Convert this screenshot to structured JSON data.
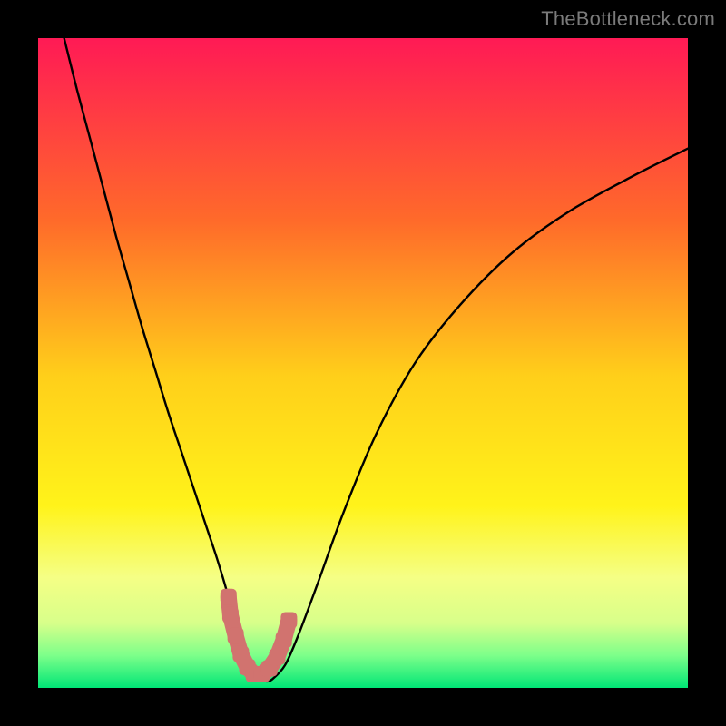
{
  "watermark": "TheBottleneck.com",
  "chart_data": {
    "type": "line",
    "title": "",
    "xlabel": "",
    "ylabel": "",
    "xlim": [
      0,
      100
    ],
    "ylim": [
      0,
      100
    ],
    "background_gradient": {
      "top": "#ff1a55",
      "mid_upper": "#ff8a1a",
      "mid": "#ffe81a",
      "mid_lower": "#f7ff6a",
      "low_band": "#9eff7a",
      "bottom": "#00e676"
    },
    "series": [
      {
        "name": "bottleneck-curve",
        "type": "line",
        "x": [
          4,
          6,
          8,
          10,
          12,
          14,
          16,
          18,
          20,
          22,
          24,
          26,
          27.5,
          29,
          30,
          31,
          32,
          33,
          34,
          35,
          36,
          38,
          40,
          43,
          47,
          52,
          58,
          65,
          73,
          82,
          92,
          100
        ],
        "y": [
          100,
          92,
          84.5,
          77,
          69.5,
          62.5,
          55.5,
          49,
          42.5,
          36.5,
          30.5,
          24.5,
          20,
          15,
          11,
          7.5,
          4.5,
          2.5,
          1.3,
          1.0,
          1.3,
          3.5,
          8,
          16,
          27,
          39,
          50,
          59,
          67,
          73.5,
          79,
          83
        ]
      },
      {
        "name": "optimal-marker",
        "type": "marker-band",
        "color": "#d1736f",
        "x": [
          29.3,
          29.6,
          30.4,
          31.2,
          32.2,
          33.2,
          34.4,
          35.6,
          36.8,
          37.8,
          38.6
        ],
        "y": [
          14.0,
          11.2,
          8.0,
          5.2,
          3.2,
          2.1,
          2.1,
          3.0,
          4.8,
          7.4,
          10.4
        ]
      }
    ]
  }
}
